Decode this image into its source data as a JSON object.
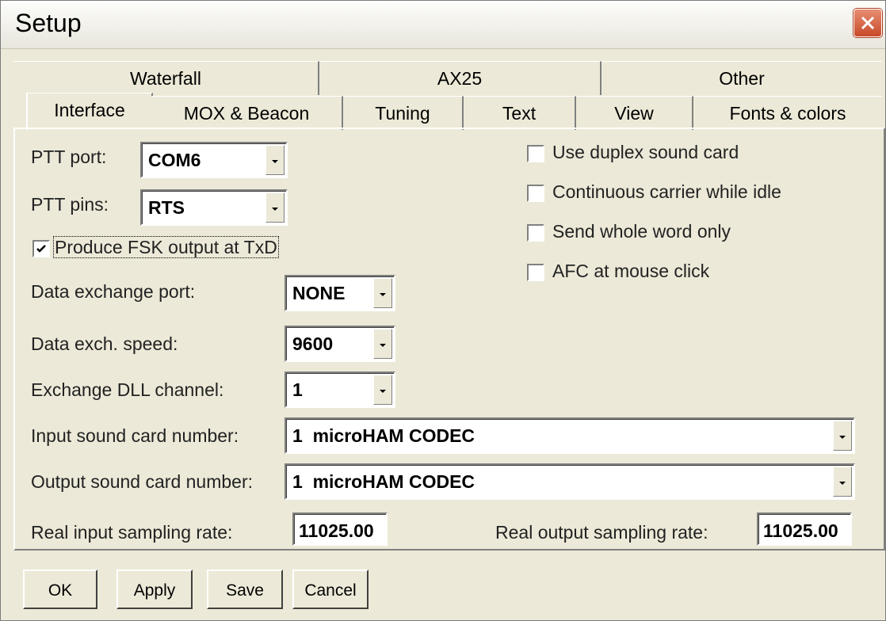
{
  "window": {
    "title": "Setup"
  },
  "tabs": {
    "row_top": [
      "Waterfall",
      "AX25",
      "Other"
    ],
    "row_bottom": [
      "Interface",
      "MOX & Beacon",
      "Tuning",
      "Text",
      "View",
      "Fonts & colors"
    ],
    "active": "Interface"
  },
  "ptt": {
    "port_label": "PTT port:",
    "port_value": "COM6",
    "pins_label": "PTT pins:",
    "pins_value": "RTS"
  },
  "fsk": {
    "label": "Produce FSK output at TxD",
    "checked": true
  },
  "options": [
    {
      "label": "Use duplex sound card",
      "checked": false
    },
    {
      "label": "Continuous carrier while idle",
      "checked": false
    },
    {
      "label": "Send whole word only",
      "checked": false
    },
    {
      "label": "AFC at mouse click",
      "checked": false
    }
  ],
  "exchange": {
    "port_label": "Data exchange port:",
    "port_value": "NONE",
    "speed_label": "Data exch. speed:",
    "speed_value": "9600",
    "dll_label": "Exchange DLL channel:",
    "dll_value": "1"
  },
  "sound": {
    "input_label": "Input sound card number:",
    "input_value": "1  microHAM CODEC",
    "output_label": "Output sound card number:",
    "output_value": "1  microHAM CODEC",
    "in_rate_label": "Real input sampling rate:",
    "in_rate_value": "11025.00",
    "out_rate_label": "Real output sampling rate:",
    "out_rate_value": "11025.00"
  },
  "buttons": {
    "ok": "OK",
    "apply": "Apply",
    "save": "Save",
    "cancel": "Cancel"
  },
  "icons": {
    "close": "close-icon",
    "check": "checkmark-icon",
    "dropdown": "chevron-down-icon"
  },
  "colors": {
    "close_button": "#c84a2a",
    "face": "#ece9d8"
  }
}
